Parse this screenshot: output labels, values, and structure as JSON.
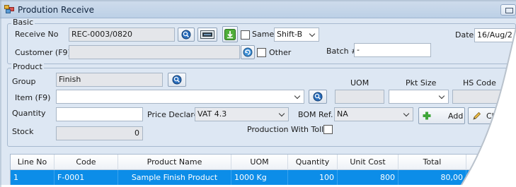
{
  "window": {
    "title": "Prodution Receive"
  },
  "basic": {
    "group_title": "Basic",
    "receive_no_label": "Receive No",
    "receive_no_value": "REC-0003/0820",
    "same_label": "Same",
    "same_checked": false,
    "shift_value": "Shift-B",
    "date_label": "Date",
    "date_value": "16/Aug/2",
    "customer_label": "Customer (F9)",
    "customer_value": "",
    "other_label": "Other",
    "other_checked": false,
    "batch_label": "Batch #",
    "batch_value": "-"
  },
  "product": {
    "group_title": "Product",
    "group_label": "Group",
    "group_value": "Finish",
    "item_label": "Item (F9)",
    "item_value": "",
    "uom_label": "UOM",
    "uom_value": "",
    "pkt_size_label": "Pkt Size",
    "pkt_size_value": "",
    "hs_code_label": "HS Code",
    "hs_code_value": "",
    "quantity_label": "Quantity",
    "quantity_value": "",
    "price_declare_label": "Price Declare",
    "price_declare_value": "VAT 4.3",
    "bom_ref_label": "BOM Ref.",
    "bom_ref_value": "NA",
    "add_label": "Add",
    "change_label": "Cha",
    "stock_label": "Stock",
    "stock_value": "0",
    "toll_label": "Production With Toll",
    "toll_checked": false
  },
  "grid": {
    "columns": [
      "Line No",
      "Code",
      "Product Name",
      "UOM",
      "Quantity",
      "Unit Cost",
      "Total"
    ],
    "rows": [
      {
        "line_no": "1",
        "code": "F-0001",
        "product_name": "Sample Finish Product",
        "uom": "1000 Kg",
        "quantity": "100",
        "unit_cost": "800",
        "total": "80,00"
      }
    ],
    "selection_color": "#0c8de8"
  },
  "icons": {
    "title": "form-icon",
    "search": "search-icon",
    "scan": "scan-icon",
    "download": "download-icon",
    "refresh": "refresh-icon",
    "add": "plus-icon",
    "change": "pencil-icon"
  }
}
